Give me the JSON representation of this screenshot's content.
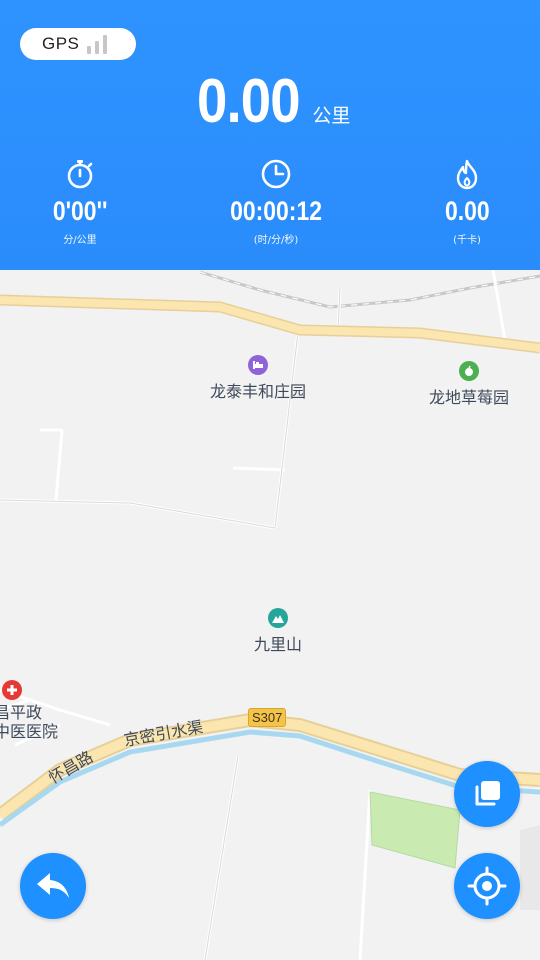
{
  "status": {
    "gps_label": "GPS"
  },
  "distance": {
    "value": "0.00",
    "unit": "公里"
  },
  "stats": [
    {
      "icon": "stopwatch-icon",
      "value": "0'00''",
      "unit": "分/公里"
    },
    {
      "icon": "clock-icon",
      "value": "00:00:12",
      "unit": "(时/分/秒)"
    },
    {
      "icon": "flame-icon",
      "value": "0.00",
      "unit": "(千卡)"
    }
  ],
  "map": {
    "pois": [
      {
        "name": "龙泰丰和庄园",
        "icon": "hotel-icon",
        "color": "#8e63d9"
      },
      {
        "name": "龙地草莓园",
        "icon": "fruit-icon",
        "color": "#4caf50"
      },
      {
        "name": "九里山",
        "icon": "mountain-icon",
        "color": "#26a69a"
      },
      {
        "name": "昌平政",
        "icon": "hospital-icon",
        "color": "#e53935"
      }
    ],
    "labels": {
      "hospital_line2": "中医医院",
      "canal": "京密引水渠",
      "road": "怀昌路",
      "shield": "S307"
    }
  },
  "buttons": {
    "layers": "layers-icon",
    "locate": "locate-icon",
    "back": "back-arrow-icon"
  },
  "colors": {
    "header": "#2e93ff",
    "fab": "#1e90ff",
    "map_bg": "#f2f2f2",
    "road_yellow": "#fae3a8",
    "canal_blue": "#a8d8f0",
    "park_green": "#c9eab0"
  }
}
